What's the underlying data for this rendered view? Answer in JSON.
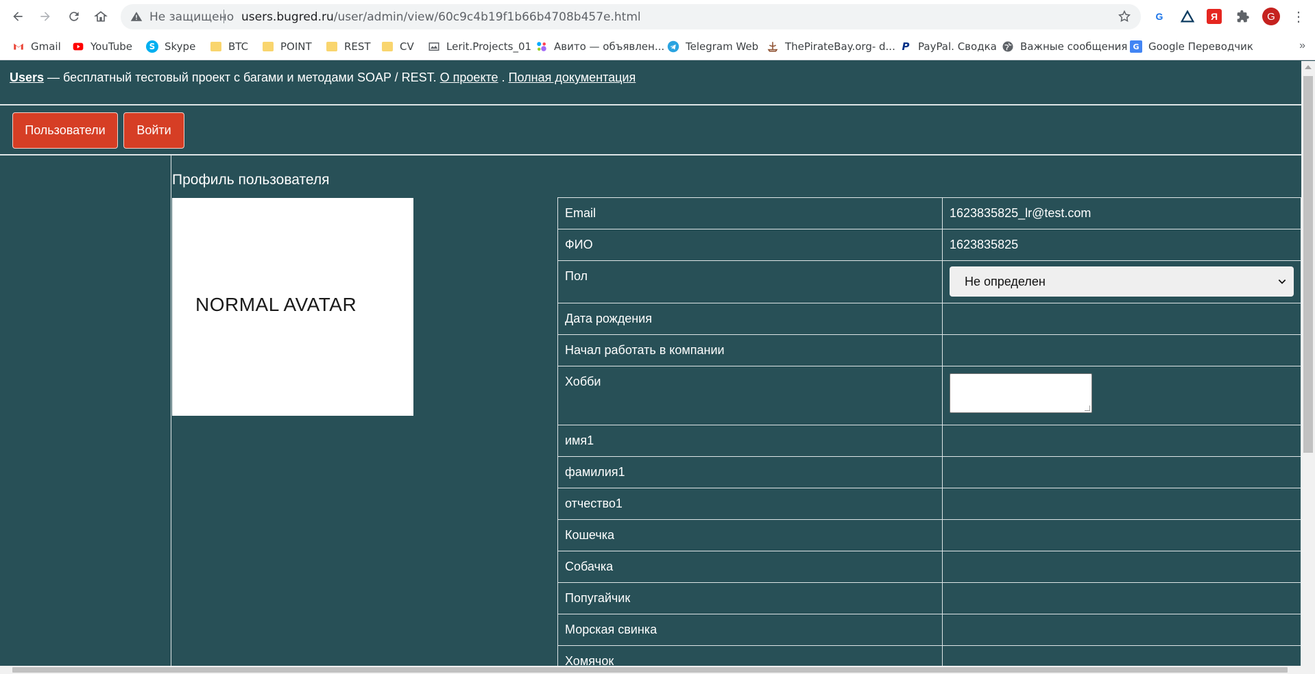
{
  "browser": {
    "security_label": "Не защищено",
    "url_host": "users.bugred.ru",
    "url_path": "/user/admin/view/60c9c4b19f1b66b4708b457e.html",
    "profile_letter": "G",
    "bookmarks": [
      {
        "label": "Gmail",
        "icon": "gmail-icon"
      },
      {
        "label": "YouTube",
        "icon": "youtube-icon"
      },
      {
        "label": "Skype",
        "icon": "skype-icon"
      },
      {
        "label": "BTC",
        "icon": "folder-icon"
      },
      {
        "label": "POINT",
        "icon": "folder-icon"
      },
      {
        "label": "REST",
        "icon": "folder-icon"
      },
      {
        "label": "CV",
        "icon": "folder-icon"
      },
      {
        "label": "Lerit.Projects_01",
        "icon": "page-icon"
      },
      {
        "label": "Авито — объявлен...",
        "icon": "avito-icon"
      },
      {
        "label": "Telegram Web",
        "icon": "telegram-icon"
      },
      {
        "label": "ThePirateBay.org- d...",
        "icon": "pirate-icon"
      },
      {
        "label": "PayPal. Сводка",
        "icon": "paypal-icon"
      },
      {
        "label": "Важные сообщения",
        "icon": "globe-icon"
      },
      {
        "label": "Google Переводчик",
        "icon": "translate-icon"
      }
    ]
  },
  "header": {
    "brand": "Users",
    "tagline": " — бесплатный тестовый проект с багами и методами SOAP / REST. ",
    "about_link": "О проекте",
    "dot": " . ",
    "docs_link": "Полная документация"
  },
  "nav": {
    "users_button": "Пользователи",
    "login_button": "Войти"
  },
  "profile": {
    "title": "Профиль пользователя",
    "avatar_text": "NORMAL AVATAR",
    "fields": {
      "email": {
        "label": "Email",
        "value": "1623835825_lr@test.com"
      },
      "fio": {
        "label": "ФИО",
        "value": "1623835825"
      },
      "gender": {
        "label": "Пол",
        "value": "Не определен"
      },
      "birthday": {
        "label": "Дата рождения",
        "value": ""
      },
      "start_work": {
        "label": "Начал работать в компании",
        "value": ""
      },
      "hobby": {
        "label": "Хобби",
        "value": ""
      },
      "name1": {
        "label": "имя1",
        "value": ""
      },
      "surname1": {
        "label": "фамилия1",
        "value": ""
      },
      "patronymic1": {
        "label": "отчество1",
        "value": ""
      },
      "cat": {
        "label": "Кошечка",
        "value": ""
      },
      "dog": {
        "label": "Собачка",
        "value": ""
      },
      "parrot": {
        "label": "Попугайчик",
        "value": ""
      },
      "guinea_pig": {
        "label": "Морская свинка",
        "value": ""
      },
      "hamster": {
        "label": "Хомячок",
        "value": ""
      }
    }
  },
  "colors": {
    "page_bg": "#285057",
    "button_red": "#d63e25",
    "divider": "#dfe6e7"
  }
}
